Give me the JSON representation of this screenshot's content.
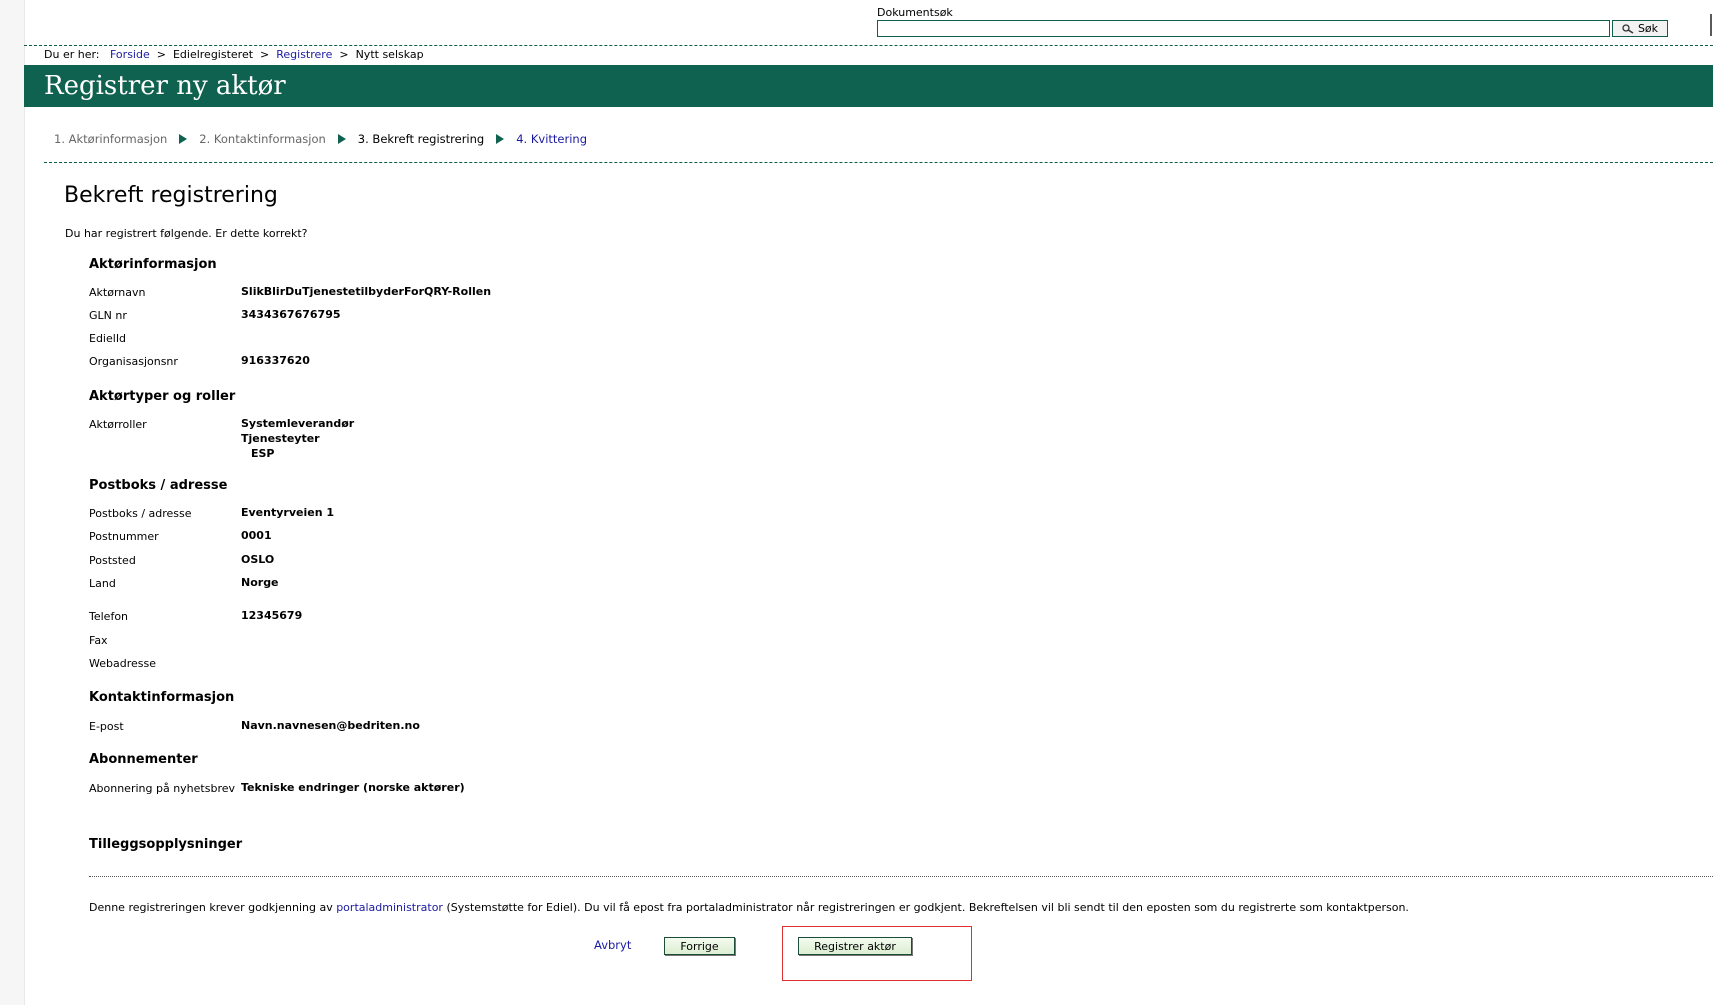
{
  "search": {
    "label": "Dokumentsøk",
    "value": "",
    "button_label": "Søk"
  },
  "breadcrumb": {
    "prefix": "Du er her:",
    "items": [
      "Forside",
      "Edielregisteret",
      "Registrere",
      "Nytt selskap"
    ],
    "separator": ">"
  },
  "header": {
    "title": "Registrer ny aktør"
  },
  "steps": [
    "1. Aktørinformasjon",
    "2. Kontaktinformasjon",
    "3. Bekreft registrering",
    "4. Kvittering"
  ],
  "main": {
    "title": "Bekreft registrering",
    "intro": "Du har registrert følgende. Er dette korrekt?",
    "sections": {
      "aktor": {
        "heading": "Aktørinformasjon",
        "rows": [
          {
            "label": "Aktørnavn",
            "value": "SlikBlirDuTjenestetilbyderForQRY-Rollen"
          },
          {
            "label": "GLN nr",
            "value": "3434367676795"
          },
          {
            "label": "EdielId",
            "value": ""
          },
          {
            "label": "Organisasjonsnr",
            "value": "916337620"
          }
        ]
      },
      "roller": {
        "heading": "Aktørtyper og roller",
        "label": "Aktørroller",
        "values": [
          "Systemleverandør",
          "Tjenesteyter",
          "ESP"
        ]
      },
      "adresse": {
        "heading": "Postboks / adresse",
        "rows": [
          {
            "label": "Postboks / adresse",
            "value": "Eventyrveien 1"
          },
          {
            "label": "Postnummer",
            "value": "0001"
          },
          {
            "label": "Poststed",
            "value": "OSLO"
          },
          {
            "label": "Land",
            "value": "Norge"
          },
          {
            "label": "Telefon",
            "value": "12345679"
          },
          {
            "label": "Fax",
            "value": ""
          },
          {
            "label": "Webadresse",
            "value": ""
          }
        ]
      },
      "kontakt": {
        "heading": "Kontaktinformasjon",
        "rows": [
          {
            "label": "E-post",
            "value": "Navn.navnesen@bedriten.no"
          }
        ]
      },
      "abonnement": {
        "heading": "Abonnementer",
        "rows": [
          {
            "label": "Abonnering på nyhetsbrev",
            "value": "Tekniske endringer (norske aktører)"
          }
        ]
      },
      "tillegg": {
        "heading": "Tilleggsopplysninger"
      }
    },
    "notice": {
      "before": "Denne registreringen krever godkjenning av ",
      "link": "portaladministrator",
      "after": " (Systemstøtte for Ediel). Du vil få epost fra portaladministrator når registreringen er godkjent. Bekreftelsen vil bli sendt til den eposten som du registrerte som kontaktperson."
    },
    "actions": {
      "cancel": "Avbryt",
      "previous": "Forrige",
      "submit": "Registrer aktør"
    }
  },
  "colors": {
    "brand": "#0f6150",
    "link": "#1a1aa0",
    "highlight": "#e03030"
  }
}
